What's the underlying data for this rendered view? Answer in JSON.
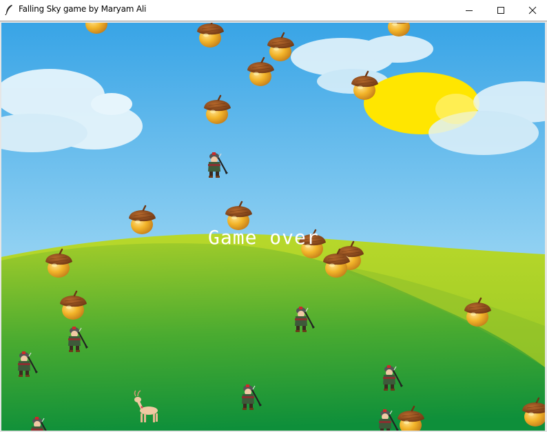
{
  "window": {
    "title": "Falling Sky game by Maryam Ali",
    "icon": "feather-icon",
    "controls": [
      "minimize-icon",
      "maximize-icon",
      "close-icon"
    ]
  },
  "game": {
    "status_text": "Game over",
    "colors": {
      "sky_top": "#38a4e6",
      "sky_bottom": "#a8dcf5",
      "grass_light": "#9fcb2a",
      "grass_dark": "#12953c",
      "sun": "#ffe600",
      "acorn": "#f3b52a",
      "acorn_cap": "#8a4b1e",
      "text": "#ffffff"
    },
    "sprites": {
      "player": "deer-icon",
      "falling_object": "acorn-icon",
      "enemy": "hunter-icon"
    }
  }
}
